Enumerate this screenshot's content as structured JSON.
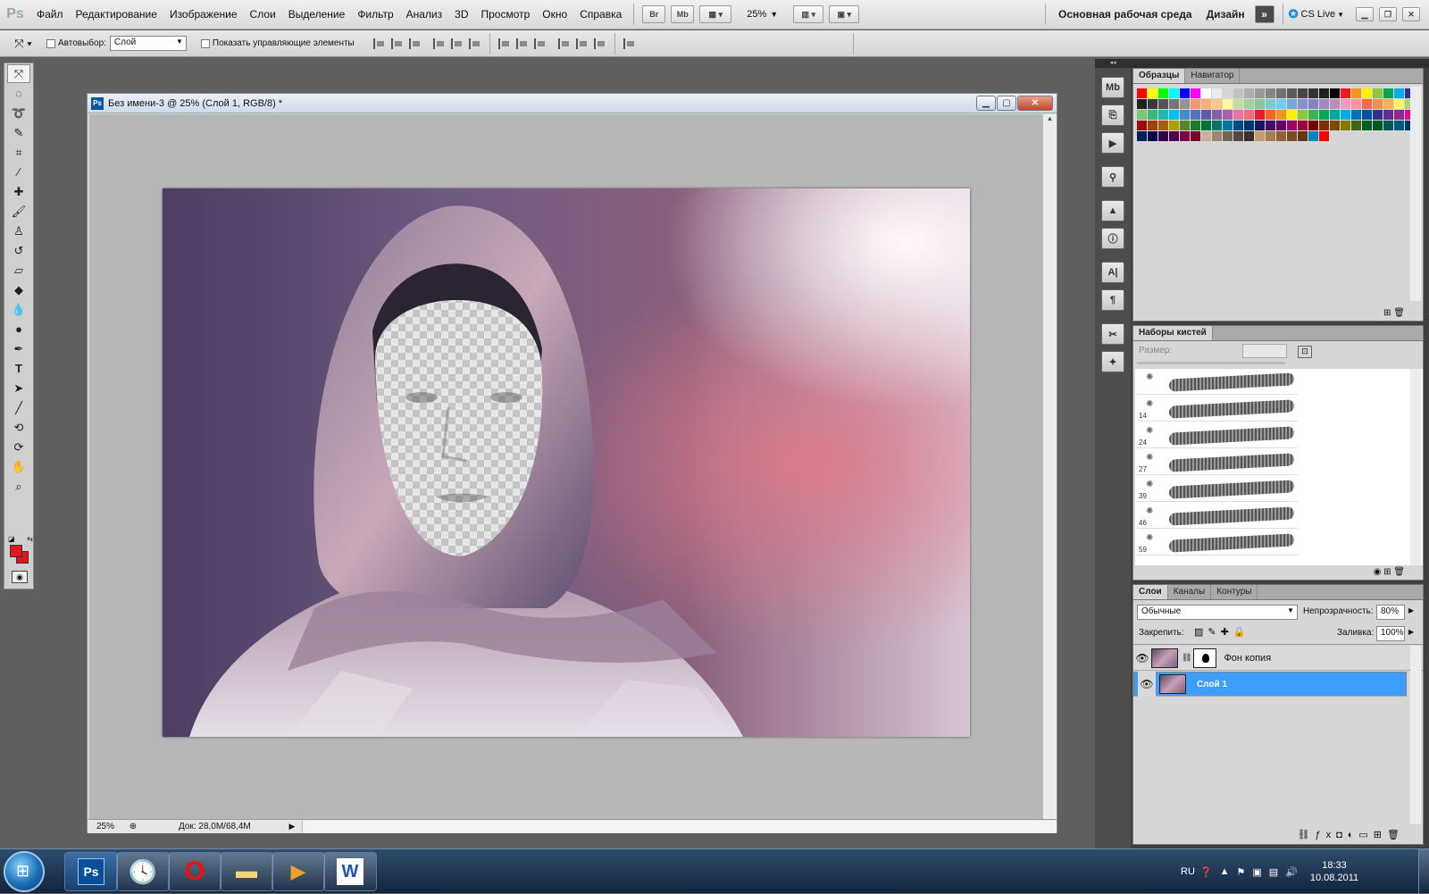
{
  "menubar": {
    "logo": "Ps",
    "items": [
      "Файл",
      "Редактирование",
      "Изображение",
      "Слои",
      "Выделение",
      "Фильтр",
      "Анализ",
      "3D",
      "Просмотр",
      "Окно",
      "Справка"
    ],
    "btn_br": "Br",
    "btn_mb": "Mb",
    "zoom": "25%",
    "workspace": "Основная рабочая среда",
    "design": "Дизайн",
    "cslive": "CS Live"
  },
  "options": {
    "autoselect_label": "Автовыбор:",
    "autoselect_value": "Слой",
    "show_controls_label": "Показать управляющие элементы"
  },
  "document": {
    "title": "Без имени-3 @ 25% (Слой 1, RGB/8) *",
    "zoom": "25%",
    "doc_size": "Док: 28,0M/68,4M"
  },
  "panels": {
    "swatches_tab": "Образцы",
    "navigator_tab": "Навигатор",
    "brushes_tab": "Наборы кистей",
    "size_label": "Размер:",
    "brush_sizes": [
      "",
      "14",
      "24",
      "27",
      "39",
      "46",
      "59"
    ],
    "layers_tab": "Слои",
    "channels_tab": "Каналы",
    "paths_tab": "Контуры",
    "blend_mode": "Обычные",
    "opacity_label": "Непрозрачность:",
    "opacity": "80%",
    "lock_label": "Закрепить:",
    "fill_label": "Заливка:",
    "fill": "100%",
    "layers": [
      "Фон копия",
      "Слой 1"
    ]
  },
  "taskbar": {
    "lang": "RU",
    "time": "18:33",
    "date": "10.08.2011"
  },
  "colors": {
    "foreground": "#e8141c",
    "background": "#e8141c",
    "selected_layer": "#3c9dfb"
  }
}
